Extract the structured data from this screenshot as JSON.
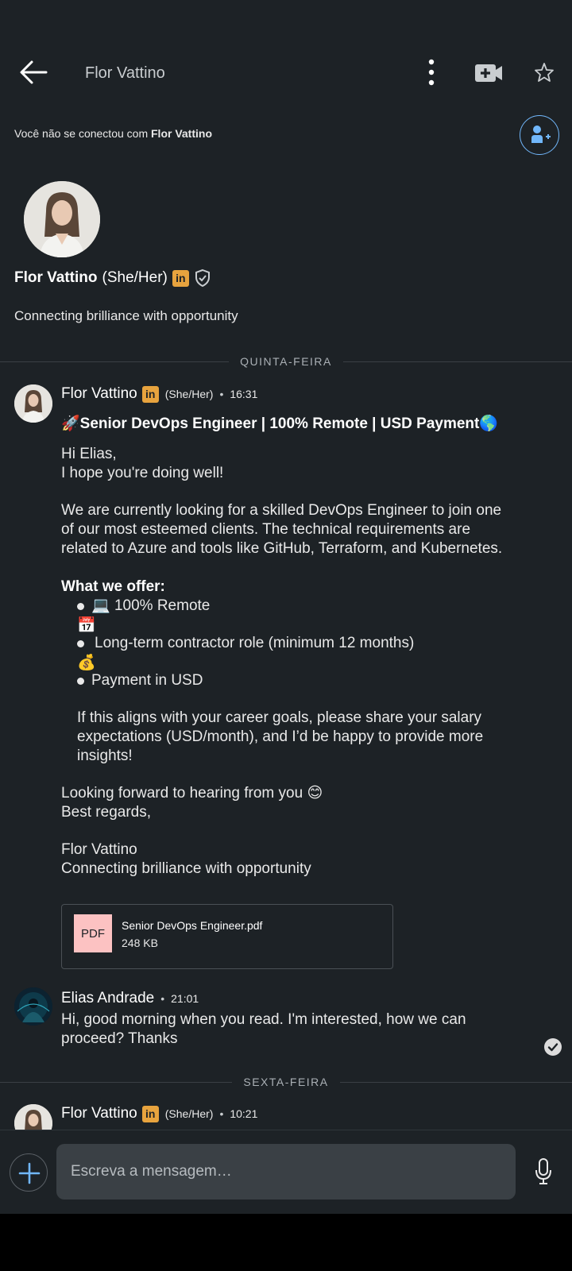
{
  "header": {
    "title": "Flor Vattino",
    "back_icon": "arrow-left-icon",
    "more_icon": "kebab-icon",
    "video_icon": "video-plus-icon",
    "star_icon": "star-icon"
  },
  "connection": {
    "prefix": "Você não se conectou com ",
    "name": "Flor Vattino",
    "icon": "add-person-icon"
  },
  "profile": {
    "name": "Flor Vattino",
    "pronouns": "(She/Her)",
    "badge": "in",
    "verified_icon": "shield-check-icon",
    "headline": "Connecting brilliance with opportunity"
  },
  "days": {
    "thursday": "QUINTA-FEIRA",
    "friday": "SEXTA-FEIRA"
  },
  "messages": [
    {
      "sender": "Flor Vattino",
      "badge": "in",
      "pronouns": "(She/Her)",
      "separator": "•",
      "time": "16:31",
      "subject_rocket": "🚀",
      "subject": "Senior DevOps Engineer | 100% Remote | USD Payment",
      "subject_globe": "🌎",
      "greeting": "Hi Elias,",
      "line2": "I hope you're doing well!",
      "para1_l1": "We are currently looking for a skilled DevOps Engineer to join one",
      "para1_l2": "of our most esteemed clients. The technical requirements are",
      "para1_l3": "related to Azure and tools like GitHub, Terraform, and Kubernetes.",
      "offer_heading": "What we offer:",
      "offer1_icon": "💻",
      "offer1": "100% Remote",
      "calendar_icon": "📅",
      "offer2": "Long-term contractor role (minimum 12 months)",
      "money_icon": "💰",
      "offer3": "Payment in USD",
      "para2_l1": "If this aligns with your career goals, please share your salary",
      "para2_l2": "expectations (USD/month), and I’d be happy to provide more",
      "para2_l3": "insights!",
      "closing1": "Looking forward to hearing from you",
      "smile": "😊",
      "closing2": "Best regards,",
      "sig_name": "Flor Vattino",
      "sig_headline": "Connecting brilliance with opportunity",
      "attachment": {
        "type": "PDF",
        "name": "Senior DevOps Engineer.pdf",
        "size": "248 KB"
      }
    },
    {
      "sender": "Elias Andrade",
      "separator": "•",
      "time": "21:01",
      "line1": "Hi, good morning when you read. I'm interested, how we can",
      "line2": "proceed? Thanks",
      "status_icon": "read-check-icon"
    },
    {
      "sender": "Flor Vattino",
      "badge": "in",
      "pronouns": "(She/Her)",
      "separator": "•",
      "time": "10:21"
    }
  ],
  "composer": {
    "placeholder": "Escreva a mensagem…",
    "plus_icon": "plus-icon",
    "mic_icon": "microphone-icon"
  },
  "colors": {
    "background": "#1d2226",
    "accent": "#71b7fb",
    "linkedin_badge": "#e7a33e",
    "pdf_tile": "#fcc2c2"
  }
}
